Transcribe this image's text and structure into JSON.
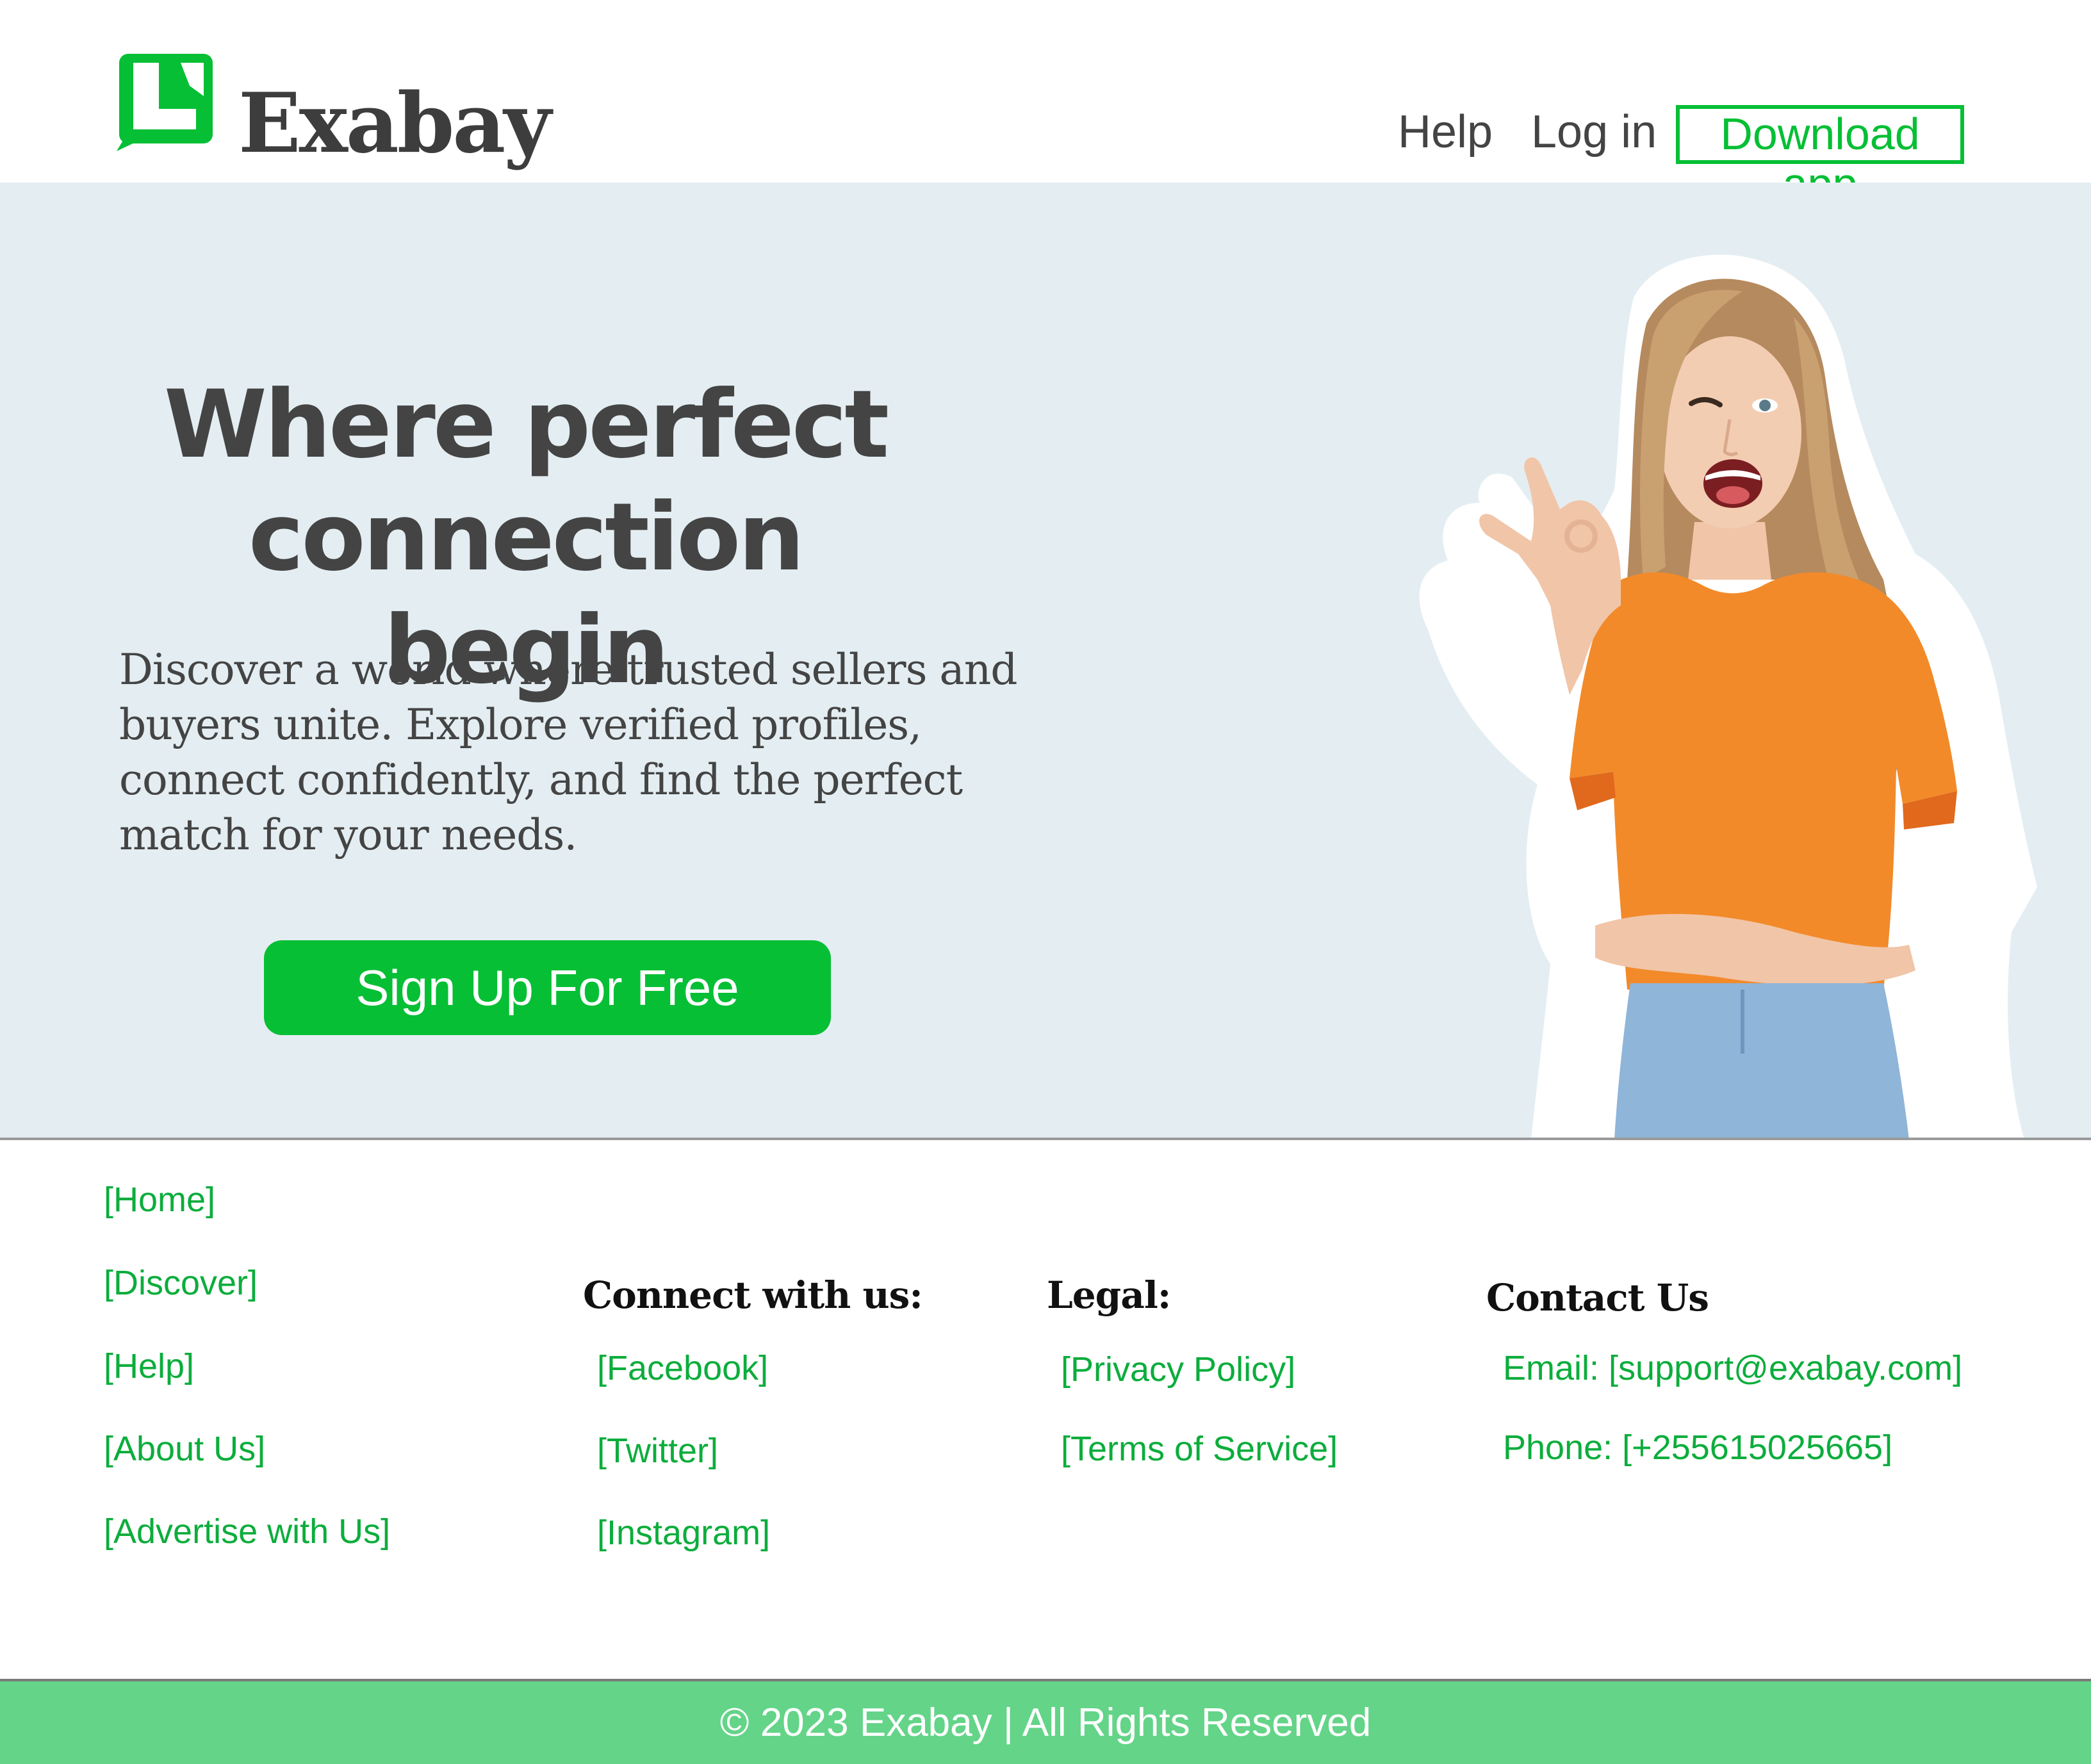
{
  "header": {
    "brand": "Exabay",
    "nav": {
      "help": "Help",
      "login": "Log in",
      "download": "Download app"
    }
  },
  "hero": {
    "title_line1": "Where perfect",
    "title_line2": "connection begin",
    "description": "Discover a world where trusted sellers and buyers unite. Explore verified profiles, connect confidently, and find the perfect match for your needs.",
    "cta": "Sign Up For Free"
  },
  "footer": {
    "site_links": [
      "[Home]",
      "[Discover]",
      "[Help]",
      "[About Us]",
      "[Advertise with Us]"
    ],
    "connect": {
      "heading": "Connect with us:",
      "links": [
        "[Facebook]",
        "[Twitter]",
        "[Instagram]"
      ]
    },
    "legal": {
      "heading": "Legal:",
      "links": [
        "[Privacy Policy]",
        "[Terms of Service]"
      ]
    },
    "contact": {
      "heading": "Contact Us",
      "email": "Email: [support@exabay.com]",
      "phone": "Phone: [+255615025665]"
    },
    "copyright": "© 2023 Exabay | All Rights Reserved"
  },
  "colors": {
    "brand_green": "#06bf35",
    "link_green": "#0cad3c",
    "hero_bg": "#e4eef2",
    "bottom_bar": "#64d488",
    "text_dark": "#444444"
  }
}
